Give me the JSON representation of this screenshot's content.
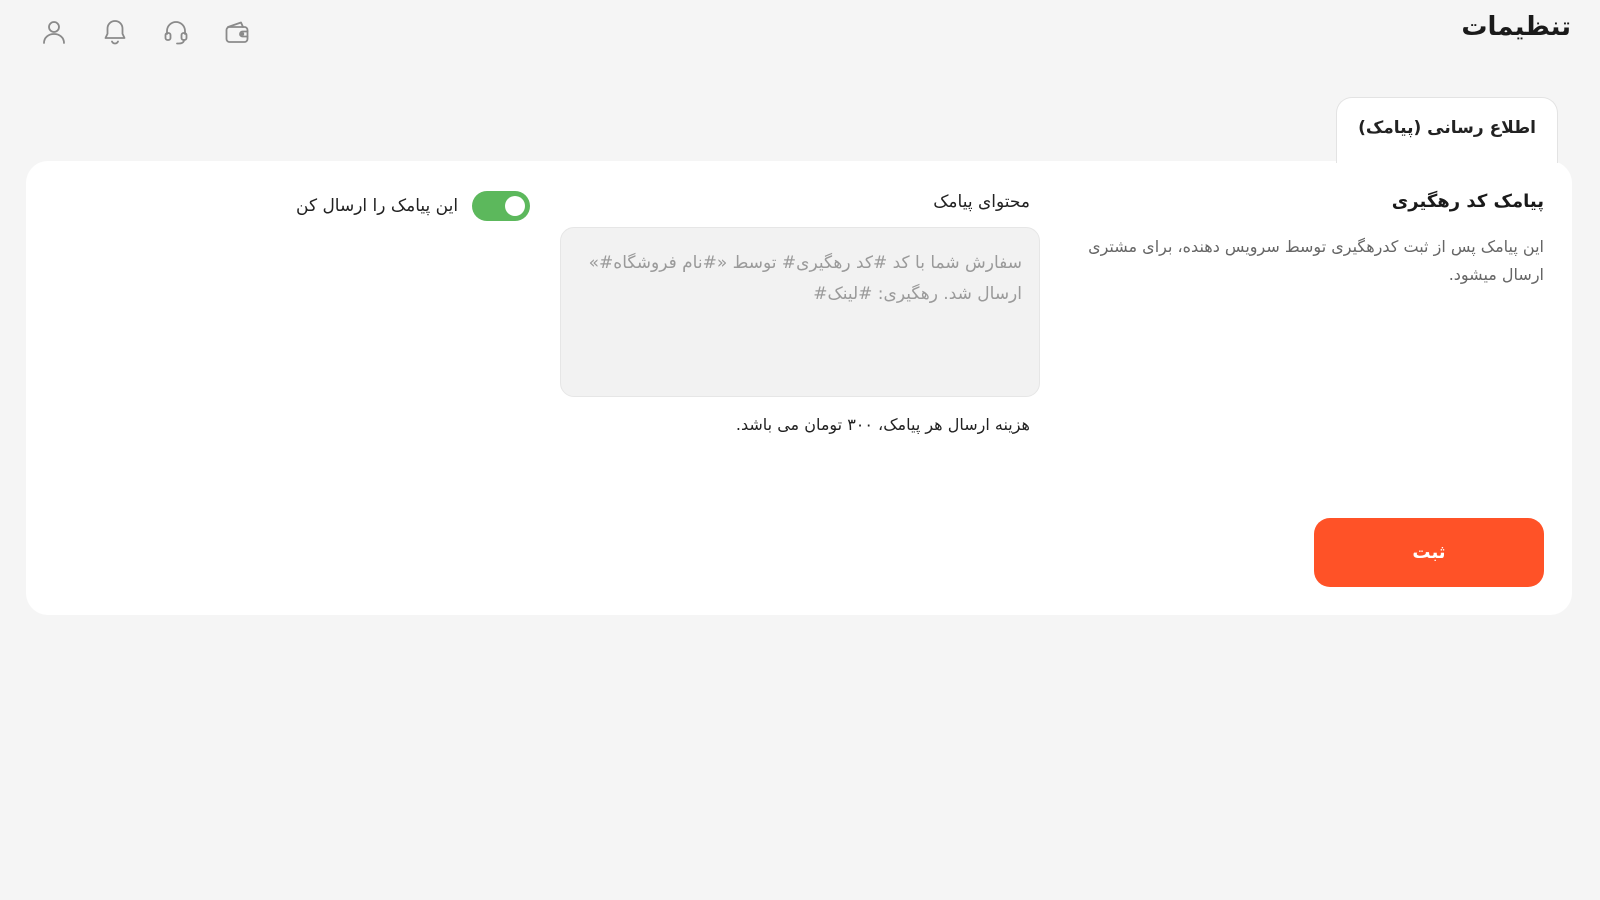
{
  "header": {
    "title": "تنظیمات",
    "icons": [
      "user-icon",
      "bell-icon",
      "headset-icon",
      "wallet-icon"
    ]
  },
  "tabs": [
    {
      "label": "اطلاع رسانی (پیامک)",
      "active": true
    }
  ],
  "section": {
    "title": "پیامک کد رهگیری",
    "description": "این پیامک پس از ثبت کدرهگیری توسط سرویس دهنده، برای مشتری ارسال میشود."
  },
  "message": {
    "label": "محتوای پیامک",
    "placeholder": "سفارش شما با کد #کد رهگیری# توسط «#نام فروشگاه#» ارسال شد. رهگیری: #لینک#",
    "value": "",
    "cost_note": "هزینه ارسال هر پیامک، ۳۰۰ تومان می باشد."
  },
  "toggle": {
    "label": "این پیامک را ارسال کن",
    "enabled": true
  },
  "actions": {
    "submit_label": "ثبت"
  },
  "colors": {
    "accent": "#ff5227",
    "toggle_on": "#5cb85c",
    "icon": "#8a8a8a"
  }
}
